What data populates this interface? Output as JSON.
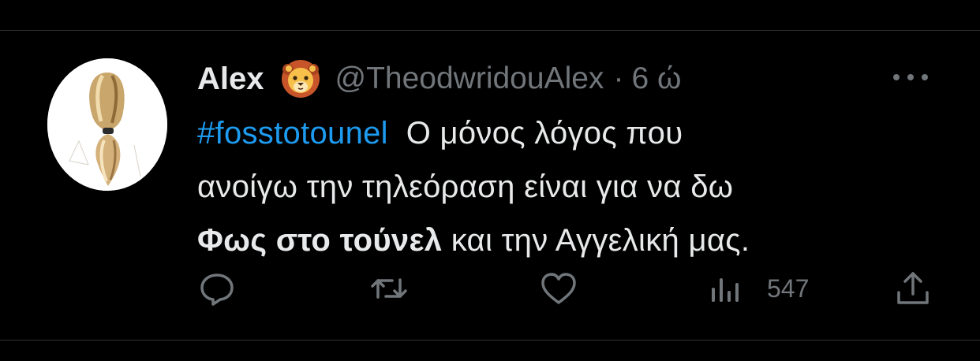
{
  "tweet": {
    "display_name": "Alex",
    "badge_emoji": "lion-emoji",
    "handle": "@TheodwridouAlex",
    "separator": "·",
    "time": "6 ώ",
    "text": {
      "hashtag": "#fosstotounel",
      "line1_rest": "Ο μόνος λόγος που",
      "line2": "ανοίγω την τηλεόραση είναι για να δω",
      "bold_phrase": "Φως στο τούνελ",
      "line3_rest": "και  την Αγγελική μας."
    },
    "actions": {
      "reply_icon": "reply-icon",
      "retweet_icon": "retweet-icon",
      "like_icon": "heart-icon",
      "views_icon": "analytics-icon",
      "views_count": "547",
      "share_icon": "share-icon"
    }
  },
  "colors": {
    "background": "#000000",
    "text_primary": "#e7e9ea",
    "text_secondary": "#71767b",
    "hashtag": "#1d9bf0",
    "divider": "#2f3336"
  }
}
